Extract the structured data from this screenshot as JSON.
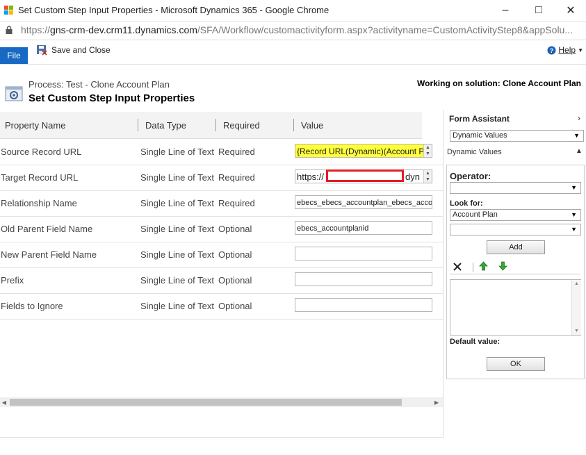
{
  "window": {
    "title": "Set Custom Step Input Properties - Microsoft Dynamics 365 - Google Chrome",
    "minimize": "–",
    "maximize": "□",
    "close": "✕"
  },
  "address": {
    "prefix": "https://",
    "host": "gns-crm-dev.crm11.dynamics.com",
    "path": "/SFA/Workflow/customactivityform.aspx?activityname=CustomActivityStep8&appSolu..."
  },
  "ribbon": {
    "file": "File",
    "save_close": "Save and Close",
    "help": "Help"
  },
  "header": {
    "process": "Process: Test - Clone Account Plan",
    "title": "Set Custom Step Input Properties",
    "solution": "Working on solution: Clone Account Plan"
  },
  "grid": {
    "columns": [
      "Property Name",
      "Data Type",
      "Required",
      "Value"
    ],
    "rows": [
      {
        "name": "Source Record URL",
        "type": "Single Line of Text",
        "required": "Required",
        "value": "{Record URL(Dynamic)(Account Plan)}"
      },
      {
        "name": "Target Record URL",
        "type": "Single Line of Text",
        "required": "Required",
        "value_prefix": "https://",
        "value_suffix": "dyn"
      },
      {
        "name": "Relationship Name",
        "type": "Single Line of Text",
        "required": "Required",
        "value": "ebecs_ebecs_accountplan_ebecs_account"
      },
      {
        "name": "Old Parent Field Name",
        "type": "Single Line of Text",
        "required": "Optional",
        "value": "ebecs_accountplanid"
      },
      {
        "name": "New Parent Field Name",
        "type": "Single Line of Text",
        "required": "Optional",
        "value": ""
      },
      {
        "name": "Prefix",
        "type": "Single Line of Text",
        "required": "Optional",
        "value": ""
      },
      {
        "name": "Fields to Ignore",
        "type": "Single Line of Text",
        "required": "Optional",
        "value": ""
      }
    ]
  },
  "form_assistant": {
    "title": "Form Assistant",
    "mode_select": "Dynamic Values",
    "section": "Dynamic Values",
    "operator_label": "Operator:",
    "operator_value": "",
    "look_for_label": "Look for:",
    "look_for_value": "Account Plan",
    "field_value": "",
    "add": "Add",
    "default_label": "Default value:",
    "ok": "OK"
  },
  "colors": {
    "file_tab": "#1769c4",
    "highlight": "#ffff3a",
    "redaction_border": "#e31e24"
  }
}
